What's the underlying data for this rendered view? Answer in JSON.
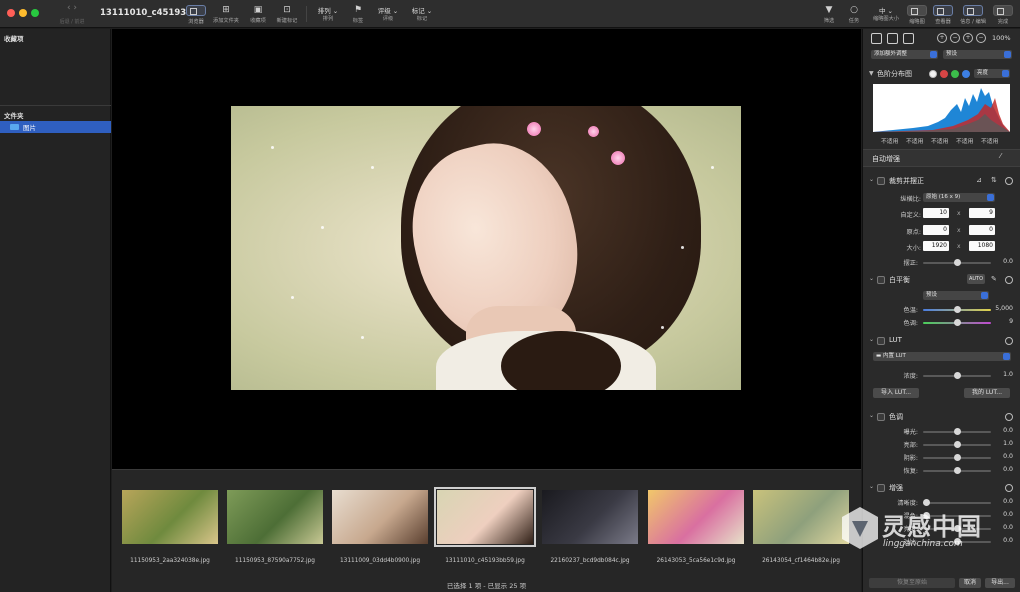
{
  "window": {
    "title": "13111010_c45193b..."
  },
  "nav": {
    "arrows": "‹   ›",
    "label": "后退 / 前进"
  },
  "toolbar": {
    "browser": "浏览器",
    "add_folder": "添加文件夹",
    "favorites": "收藏项",
    "new_tag": "新建标记",
    "sort_value": "排列",
    "sort": "排列",
    "label_flag": "标签",
    "rating_value": "评级",
    "rating": "评级",
    "tag_value": "标记",
    "tag": "标记",
    "filter": "筛选",
    "tasks": "任务",
    "size_value": "中",
    "thumb_size": "缩略图大小",
    "thumbnail": "缩略图",
    "viewer": "查看器",
    "info_edit": "信息 / 编辑",
    "done": "完成"
  },
  "sidebar": {
    "favorites_header": "收藏项",
    "folders_header": "文件夹",
    "folder_item": "图片"
  },
  "filmstrip": {
    "thumbs": [
      {
        "name": "11150953_2aa324038e.jpg",
        "colors": [
          "#b8a55a",
          "#6f8a3e",
          "#d9c58a"
        ]
      },
      {
        "name": "11150953_87590a7752.jpg",
        "colors": [
          "#7e9b58",
          "#4d6e36",
          "#c8c894"
        ]
      },
      {
        "name": "13111009_03dd4b0900.jpg",
        "colors": [
          "#e8ddd0",
          "#c7a88e",
          "#5a3f2f"
        ]
      },
      {
        "name": "13111010_c45193bb59.jpg",
        "colors": [
          "#d8d5b3",
          "#eecfbf",
          "#2f1f16"
        ]
      },
      {
        "name": "22160237_bcd9db084c.jpg",
        "colors": [
          "#1a1a1f",
          "#3a3a44",
          "#7a7a88"
        ]
      },
      {
        "name": "26143053_5ca56e1c9d.jpg",
        "colors": [
          "#f1c76a",
          "#d96fa0",
          "#e7e1c9"
        ]
      },
      {
        "name": "26143054_cf1464b82e.jpg",
        "colors": [
          "#c9c27c",
          "#8ea07c",
          "#e0d7a0"
        ]
      }
    ],
    "status": "已选择 1 项 - 已显示 25 项"
  },
  "panel": {
    "zoom_pct": "100%",
    "add_adjustment": "添加额外调整",
    "preset": "预设",
    "histogram": {
      "title": "色阶分布图",
      "channel": "亮度",
      "labels": [
        "不适用",
        "不适用",
        "不适用",
        "不适用",
        "不适用"
      ]
    },
    "auto_enhance": "自动增强",
    "crop": {
      "title": "裁剪并摆正",
      "ratio_label": "纵横比:",
      "ratio_value": "原始 (16 x 9)",
      "custom_label": "自定义:",
      "custom_w": "10",
      "custom_h": "9",
      "origin_label": "原点:",
      "origin_x": "0",
      "origin_y": "0",
      "size_label": "大小:",
      "size_w": "1920",
      "size_h": "1080",
      "straighten_label": "摆正:",
      "straighten_value": "0.0",
      "straighten_level": 0.5,
      "x": "x"
    },
    "white_balance": {
      "title": "白平衡",
      "auto": "AUTO",
      "preset": "预设",
      "temp_label": "色温:",
      "temp_value": "5,000",
      "temp_level": 0.5,
      "tint_label": "色调:",
      "tint_value": "9",
      "tint_level": 0.5
    },
    "lut": {
      "title": "LUT",
      "builtin": "内置 LUT",
      "density_label": "浓度:",
      "density_value": "1.0",
      "density_level": 0.5,
      "import_btn": "导入 LUT...",
      "my_btn": "我的 LUT..."
    },
    "tone": {
      "title": "色调",
      "rows": [
        {
          "label": "曝光:",
          "value": "0.0",
          "level": 0.5
        },
        {
          "label": "亮部:",
          "value": "1.0",
          "level": 0.5
        },
        {
          "label": "阴影:",
          "value": "0.0",
          "level": 0.5
        },
        {
          "label": "恢复:",
          "value": "0.0",
          "level": 0.5
        }
      ]
    },
    "enhance": {
      "title": "增强",
      "rows": [
        {
          "label": "清晰度:",
          "value": "0.0",
          "level": 0.0
        },
        {
          "label": "混色:",
          "value": "0.0",
          "level": 0.0
        },
        {
          "label": "亮度:",
          "value": "0.0",
          "level": 0.5
        },
        {
          "label": "对比:",
          "value": "0.0",
          "level": 0.5
        }
      ]
    },
    "footer": {
      "reset_btn": "恢复至原始",
      "cancel_btn": "取消",
      "export_btn": "导出..."
    }
  },
  "watermark": {
    "cn": "灵感中国",
    "en": "lingganchina.com"
  }
}
